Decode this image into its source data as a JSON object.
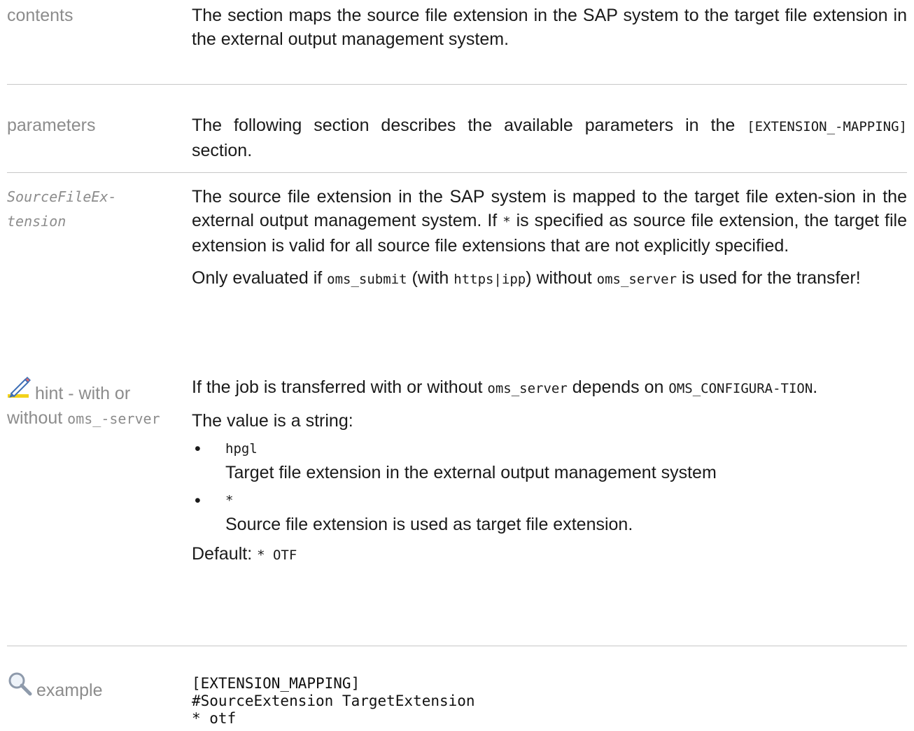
{
  "contents": {
    "label": "contents",
    "text": "The section maps the source file extension in the SAP system to the target file extension in the external output management system."
  },
  "parameters": {
    "label": "parameters",
    "text_1": "The following section describes the available parameters in the ",
    "code": "[EXTENSION_-MAPPING]",
    "text_2": " section."
  },
  "source_file_extension": {
    "label_1": "SourceFileEx-",
    "label_2": "tension",
    "para1_a": "The source file extension in the SAP system is mapped to the target file exten-sion in the external output management system. If ",
    "para1_code": "*",
    "para1_b": " is specified as source file extension, the target file extension is valid for all source file extensions that are not explicitly specified.",
    "para2_a": "Only evaluated if ",
    "para2_code1": "oms_submit",
    "para2_b": " (with ",
    "para2_code2": "https|ipp",
    "para2_c": ") without ",
    "para2_code3": "oms_server",
    "para2_d": " is used for the transfer!"
  },
  "hint": {
    "icon": "pencil-hint-icon",
    "label_1": "hint - with or",
    "label_2": "without ",
    "label_code": "oms_-server",
    "text_a": "If the job is transferred with or without ",
    "text_code1": "oms_server",
    "text_b": " depends on ",
    "text_code2": "OMS_CONFIGURA-TION",
    "text_c": "."
  },
  "value": {
    "intro": "The value is a string:",
    "items": [
      {
        "code": "hpgl",
        "desc": "Target file extension in the external output management system"
      },
      {
        "code": "*",
        "desc": "Source file extension is used as target file extension."
      }
    ],
    "default_label": "Default: ",
    "default_code": "* OTF"
  },
  "example": {
    "icon": "magnifier-icon",
    "label": "example",
    "code_lines": [
      "[EXTENSION_MAPPING]",
      "#SourceExtension TargetExtension",
      "* otf"
    ]
  }
}
